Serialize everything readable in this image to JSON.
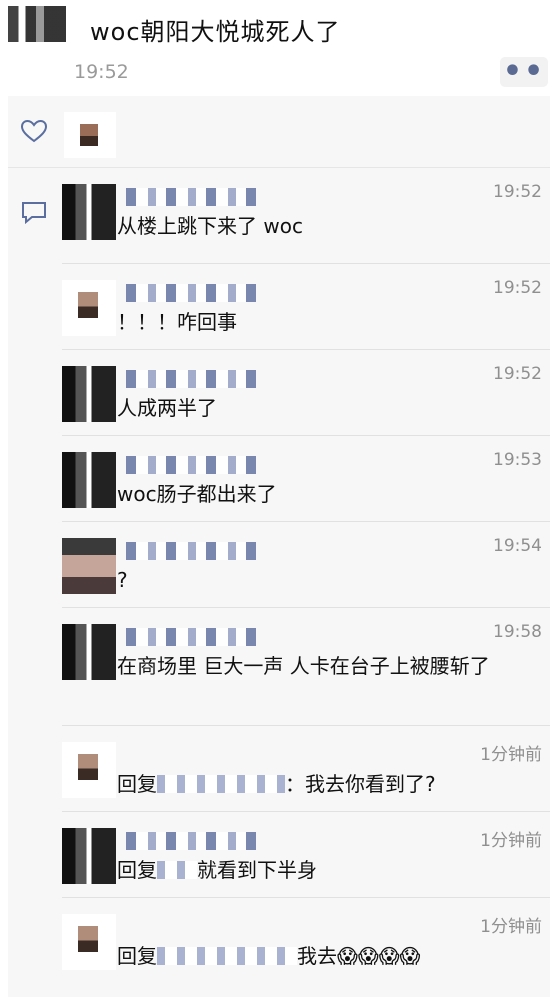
{
  "post": {
    "title": "woc朝阳大悦城死人了",
    "time": "19:52",
    "more_label": "••"
  },
  "comments": [
    {
      "time": "19:52",
      "text": "从楼上跳下来了 woc"
    },
    {
      "time": "19:52",
      "text": "！！！咋回事"
    },
    {
      "time": "19:52",
      "text": "人成两半了"
    },
    {
      "time": "19:53",
      "text": "woc肠子都出来了"
    },
    {
      "time": "19:54",
      "text": "?"
    },
    {
      "time": "19:58",
      "text": "在商场里 巨大一声 人卡在台子上被腰斩了"
    },
    {
      "time": "1分钟前",
      "prefix": "回复",
      "text": "：我去你看到了?"
    },
    {
      "time": "1分钟前",
      "prefix": "回复",
      "text": "就看到下半身"
    },
    {
      "time": "1分钟前",
      "prefix": "回复",
      "text": "我去😱😱😱😱"
    }
  ],
  "icons": {
    "like": "heart-icon",
    "comment": "comment-icon"
  }
}
